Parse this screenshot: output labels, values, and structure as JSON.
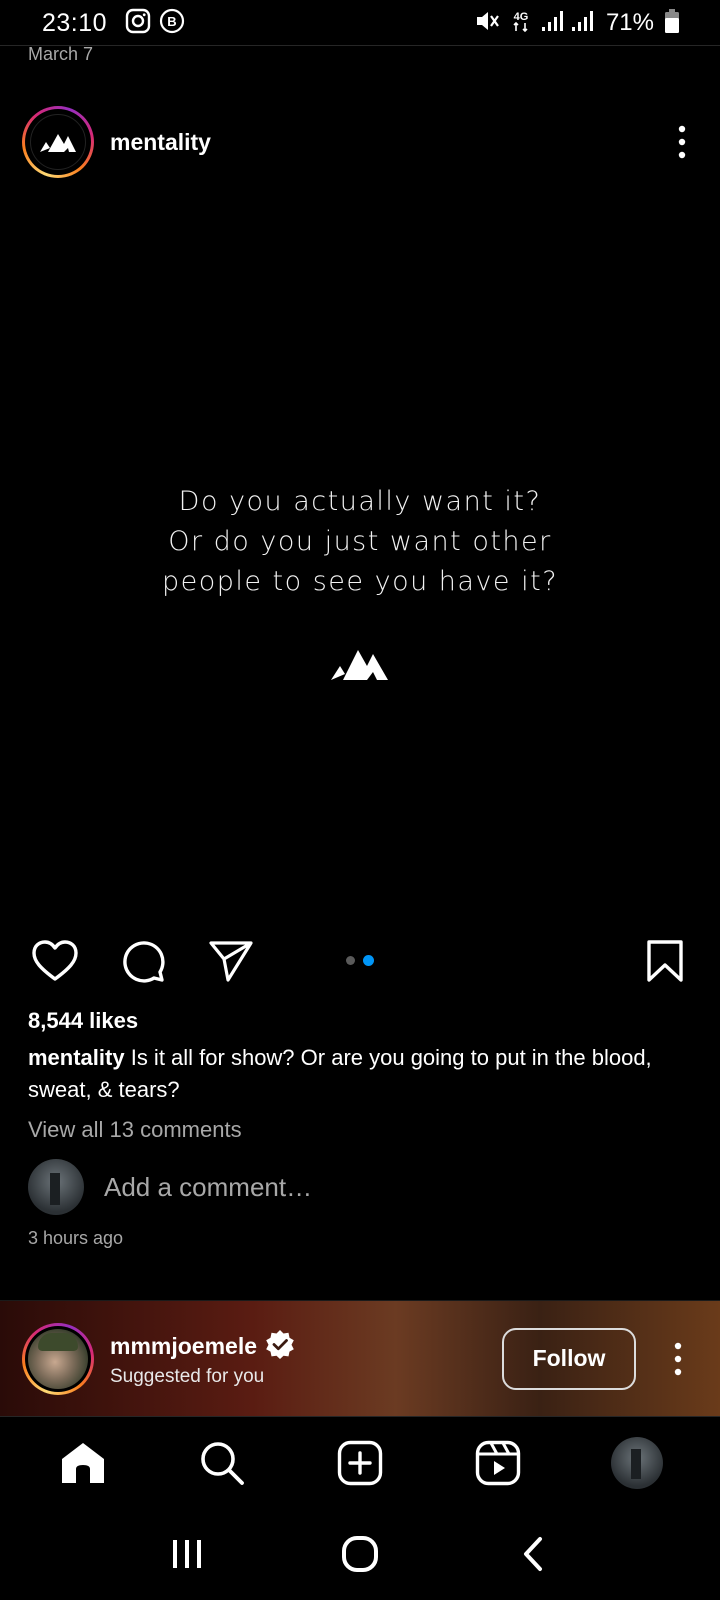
{
  "status_bar": {
    "time": "23:10",
    "battery": "71%",
    "network": "4G",
    "icons": [
      "instagram-icon",
      "b-badge-icon",
      "mute-icon",
      "signal-icon",
      "battery-icon"
    ]
  },
  "prev_post": {
    "date": "March 7"
  },
  "post": {
    "username": "mentality",
    "quote_lines": [
      "Do you actually want it?",
      "Or do you just want other",
      "people to see you have it?"
    ],
    "likes": "8,544 likes",
    "caption_user": "mentality",
    "caption_text": " Is it all for show? Or are you going to put in the blood, sweat, & tears?",
    "view_comments": "View all 13 comments",
    "comment_placeholder": "Add a comment…",
    "time_ago": "3 hours ago",
    "carousel": {
      "count": 2,
      "active": 2
    }
  },
  "suggested": {
    "username": "mmmjoemele",
    "subtitle": "Suggested for you",
    "follow_label": "Follow",
    "verified": true
  },
  "colors": {
    "accent_blue": "#0095f6",
    "muted_text": "#a8a8a8",
    "background": "#000000"
  }
}
